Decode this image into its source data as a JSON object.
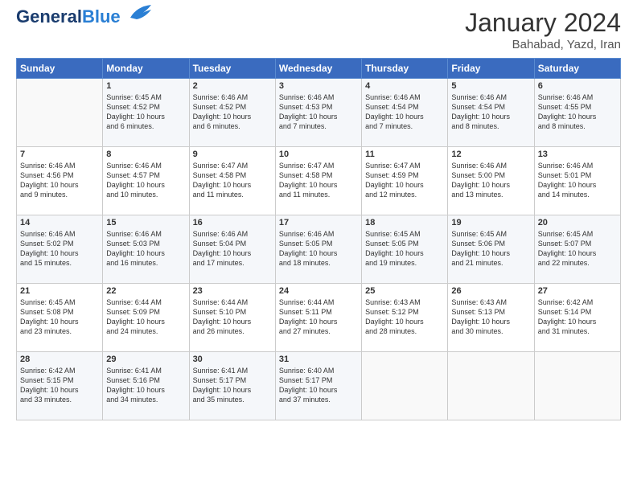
{
  "header": {
    "logo_line1": "General",
    "logo_line2": "Blue",
    "month_year": "January 2024",
    "location": "Bahabad, Yazd, Iran"
  },
  "days_of_week": [
    "Sunday",
    "Monday",
    "Tuesday",
    "Wednesday",
    "Thursday",
    "Friday",
    "Saturday"
  ],
  "weeks": [
    [
      {
        "day": "",
        "info": ""
      },
      {
        "day": "1",
        "info": "Sunrise: 6:45 AM\nSunset: 4:52 PM\nDaylight: 10 hours\nand 6 minutes."
      },
      {
        "day": "2",
        "info": "Sunrise: 6:46 AM\nSunset: 4:52 PM\nDaylight: 10 hours\nand 6 minutes."
      },
      {
        "day": "3",
        "info": "Sunrise: 6:46 AM\nSunset: 4:53 PM\nDaylight: 10 hours\nand 7 minutes."
      },
      {
        "day": "4",
        "info": "Sunrise: 6:46 AM\nSunset: 4:54 PM\nDaylight: 10 hours\nand 7 minutes."
      },
      {
        "day": "5",
        "info": "Sunrise: 6:46 AM\nSunset: 4:54 PM\nDaylight: 10 hours\nand 8 minutes."
      },
      {
        "day": "6",
        "info": "Sunrise: 6:46 AM\nSunset: 4:55 PM\nDaylight: 10 hours\nand 8 minutes."
      }
    ],
    [
      {
        "day": "7",
        "info": "Sunrise: 6:46 AM\nSunset: 4:56 PM\nDaylight: 10 hours\nand 9 minutes."
      },
      {
        "day": "8",
        "info": "Sunrise: 6:46 AM\nSunset: 4:57 PM\nDaylight: 10 hours\nand 10 minutes."
      },
      {
        "day": "9",
        "info": "Sunrise: 6:47 AM\nSunset: 4:58 PM\nDaylight: 10 hours\nand 11 minutes."
      },
      {
        "day": "10",
        "info": "Sunrise: 6:47 AM\nSunset: 4:58 PM\nDaylight: 10 hours\nand 11 minutes."
      },
      {
        "day": "11",
        "info": "Sunrise: 6:47 AM\nSunset: 4:59 PM\nDaylight: 10 hours\nand 12 minutes."
      },
      {
        "day": "12",
        "info": "Sunrise: 6:46 AM\nSunset: 5:00 PM\nDaylight: 10 hours\nand 13 minutes."
      },
      {
        "day": "13",
        "info": "Sunrise: 6:46 AM\nSunset: 5:01 PM\nDaylight: 10 hours\nand 14 minutes."
      }
    ],
    [
      {
        "day": "14",
        "info": "Sunrise: 6:46 AM\nSunset: 5:02 PM\nDaylight: 10 hours\nand 15 minutes."
      },
      {
        "day": "15",
        "info": "Sunrise: 6:46 AM\nSunset: 5:03 PM\nDaylight: 10 hours\nand 16 minutes."
      },
      {
        "day": "16",
        "info": "Sunrise: 6:46 AM\nSunset: 5:04 PM\nDaylight: 10 hours\nand 17 minutes."
      },
      {
        "day": "17",
        "info": "Sunrise: 6:46 AM\nSunset: 5:05 PM\nDaylight: 10 hours\nand 18 minutes."
      },
      {
        "day": "18",
        "info": "Sunrise: 6:45 AM\nSunset: 5:05 PM\nDaylight: 10 hours\nand 19 minutes."
      },
      {
        "day": "19",
        "info": "Sunrise: 6:45 AM\nSunset: 5:06 PM\nDaylight: 10 hours\nand 21 minutes."
      },
      {
        "day": "20",
        "info": "Sunrise: 6:45 AM\nSunset: 5:07 PM\nDaylight: 10 hours\nand 22 minutes."
      }
    ],
    [
      {
        "day": "21",
        "info": "Sunrise: 6:45 AM\nSunset: 5:08 PM\nDaylight: 10 hours\nand 23 minutes."
      },
      {
        "day": "22",
        "info": "Sunrise: 6:44 AM\nSunset: 5:09 PM\nDaylight: 10 hours\nand 24 minutes."
      },
      {
        "day": "23",
        "info": "Sunrise: 6:44 AM\nSunset: 5:10 PM\nDaylight: 10 hours\nand 26 minutes."
      },
      {
        "day": "24",
        "info": "Sunrise: 6:44 AM\nSunset: 5:11 PM\nDaylight: 10 hours\nand 27 minutes."
      },
      {
        "day": "25",
        "info": "Sunrise: 6:43 AM\nSunset: 5:12 PM\nDaylight: 10 hours\nand 28 minutes."
      },
      {
        "day": "26",
        "info": "Sunrise: 6:43 AM\nSunset: 5:13 PM\nDaylight: 10 hours\nand 30 minutes."
      },
      {
        "day": "27",
        "info": "Sunrise: 6:42 AM\nSunset: 5:14 PM\nDaylight: 10 hours\nand 31 minutes."
      }
    ],
    [
      {
        "day": "28",
        "info": "Sunrise: 6:42 AM\nSunset: 5:15 PM\nDaylight: 10 hours\nand 33 minutes."
      },
      {
        "day": "29",
        "info": "Sunrise: 6:41 AM\nSunset: 5:16 PM\nDaylight: 10 hours\nand 34 minutes."
      },
      {
        "day": "30",
        "info": "Sunrise: 6:41 AM\nSunset: 5:17 PM\nDaylight: 10 hours\nand 35 minutes."
      },
      {
        "day": "31",
        "info": "Sunrise: 6:40 AM\nSunset: 5:17 PM\nDaylight: 10 hours\nand 37 minutes."
      },
      {
        "day": "",
        "info": ""
      },
      {
        "day": "",
        "info": ""
      },
      {
        "day": "",
        "info": ""
      }
    ]
  ]
}
